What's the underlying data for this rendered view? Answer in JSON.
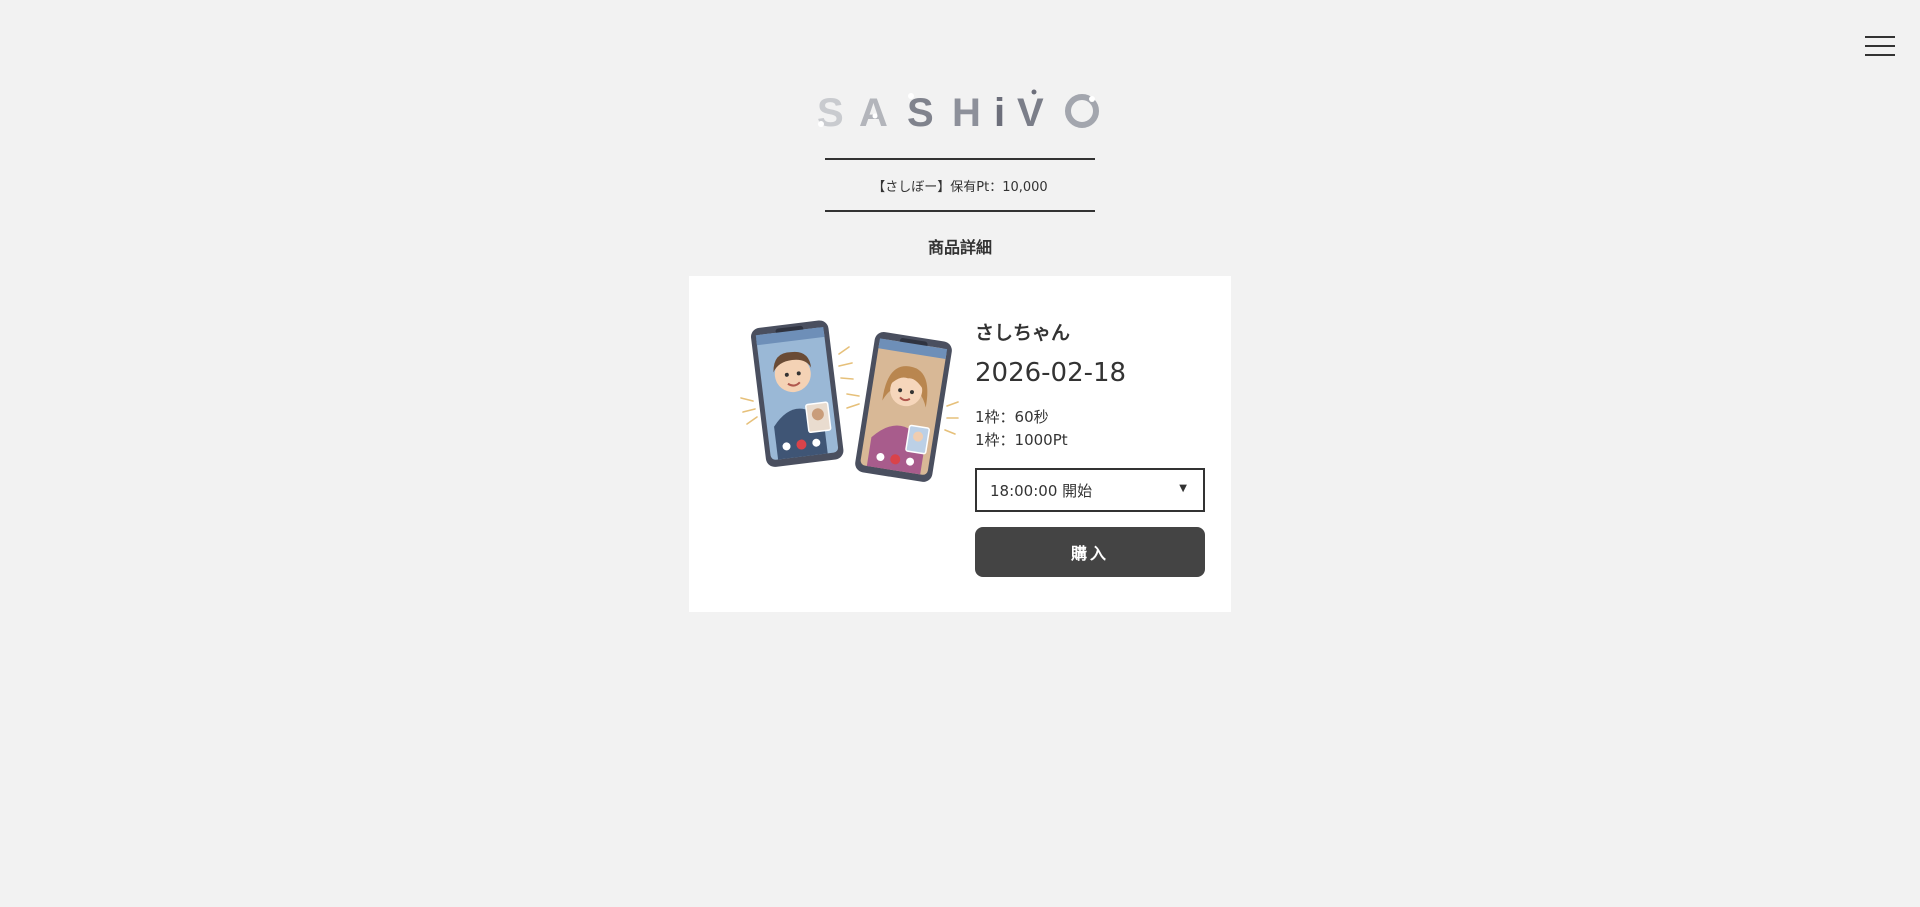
{
  "header": {
    "logo_text": "SASHiVO",
    "menu_icon": "hamburger-menu-icon"
  },
  "points": {
    "text": "【さしぼー】保有Pt：10,000"
  },
  "page": {
    "title": "商品詳細"
  },
  "product": {
    "illustration": "video-call-illustration",
    "name": "さしちゃん",
    "date": "2026-02-18",
    "frame_duration": "1枠：60秒",
    "frame_price": "1枠：1000Pt",
    "time_select": {
      "selected": "18:00:00 開始",
      "icon": "chevron-down-icon"
    },
    "buy_label": "購入"
  },
  "colors": {
    "background": "#f2f2f2",
    "card": "#ffffff",
    "text": "#333333",
    "button": "#444444",
    "logo_gray": "#6d6f7b"
  }
}
